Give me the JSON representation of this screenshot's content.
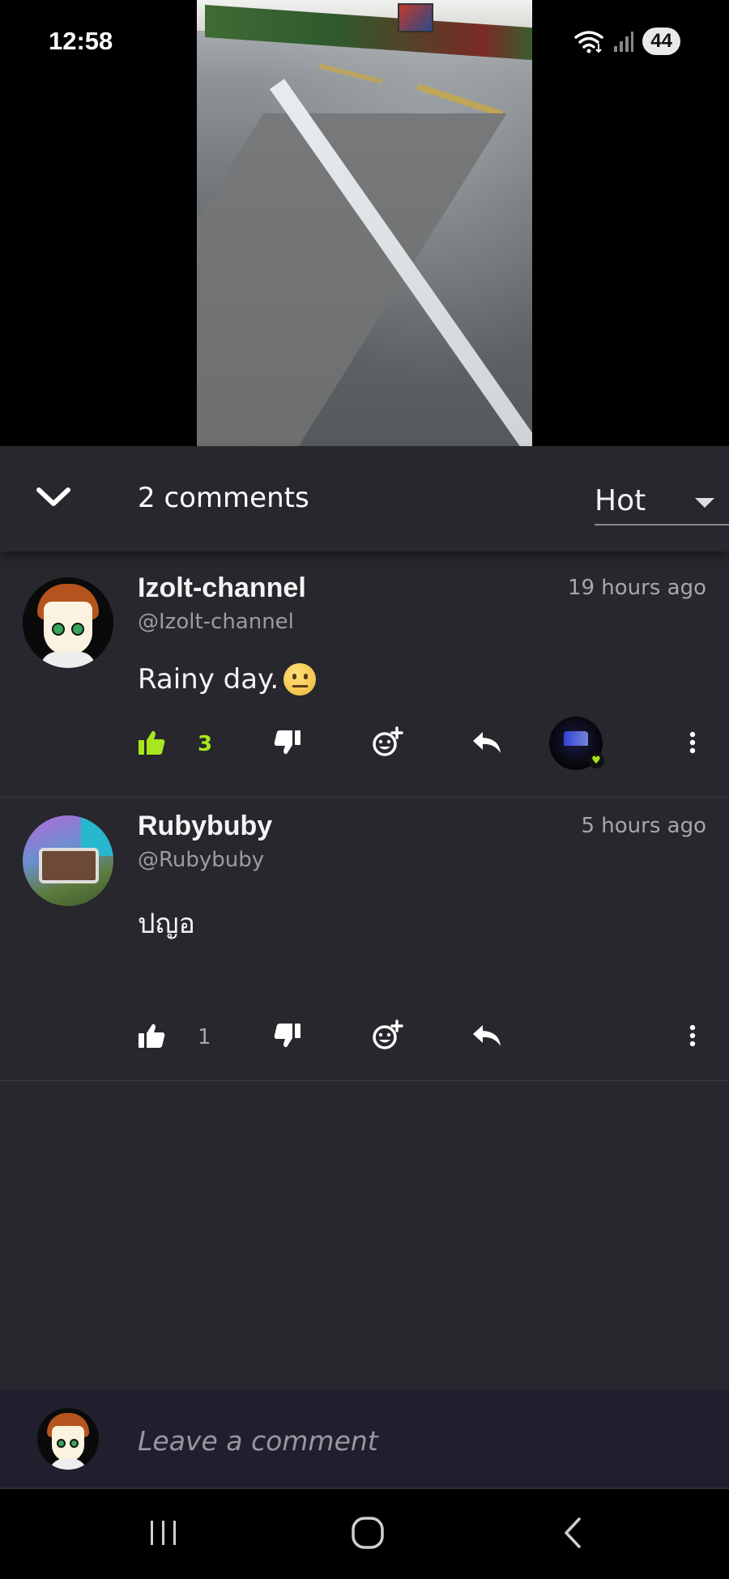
{
  "status_bar": {
    "time": "12:58",
    "battery": "44"
  },
  "header": {
    "comment_count": "2 comments",
    "sort": {
      "selected": "Hot"
    }
  },
  "comments": [
    {
      "author": "Izolt-channel",
      "handle": "@Izolt-channel",
      "timestamp": "19 hours ago",
      "text": "Rainy day.",
      "emoji": "neutral-face",
      "likes": "3",
      "liked": true,
      "like_color": "#a8e61d"
    },
    {
      "author": "Rubybuby",
      "handle": "@Rubybuby",
      "timestamp": "5 hours ago",
      "text": "ปญอ",
      "likes": "1",
      "liked": false
    }
  ],
  "composer": {
    "placeholder": "Leave a comment"
  },
  "colors": {
    "panel_bg": "#27272d",
    "accent": "#a8e61d",
    "composer_bg": "#211f2e"
  },
  "icons": [
    "chevron-down-icon",
    "like-icon",
    "dislike-icon",
    "add-reaction-icon",
    "reply-icon",
    "more-vert-icon",
    "wifi-icon",
    "signal-icon"
  ]
}
